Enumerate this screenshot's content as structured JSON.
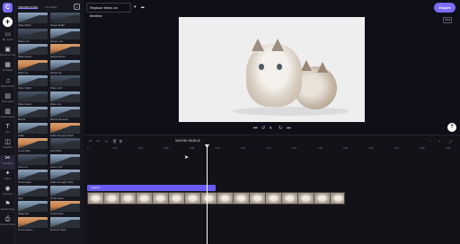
{
  "rail": {
    "logo": "C",
    "items": [
      {
        "icon": "▭",
        "label": "My media"
      },
      {
        "icon": "▣",
        "label": "Record & create"
      },
      {
        "icon": "▦",
        "label": "Templates"
      },
      {
        "icon": "♫",
        "label": "Music & SFX"
      },
      {
        "icon": "▤",
        "label": "Stock video"
      },
      {
        "icon": "▥",
        "label": "Stock images"
      },
      {
        "icon": "T",
        "label": "Text"
      },
      {
        "icon": "◫",
        "label": "Graphics"
      },
      {
        "icon": "✂",
        "label": "Transitions"
      },
      {
        "icon": "✦",
        "label": "Filters"
      },
      {
        "icon": "◉",
        "label": "Brand kit"
      },
      {
        "icon": "⚑",
        "label": "Feature flags"
      },
      {
        "icon": "⎙",
        "label": "Version history"
      }
    ]
  },
  "panel": {
    "tab_active": "TRANSITIONS",
    "tab_other": "FILTERS",
    "tiles": [
      [
        "Slide Right",
        "Swipe Right"
      ],
      [
        "Slide Left",
        "Swipe Left"
      ],
      [
        "Slide Down",
        "Swipe Down"
      ],
      [
        "Slide Up",
        "Swipe Up"
      ],
      [
        "Wipe Right",
        "Wipe Left"
      ],
      [
        "Wipe Down",
        "Wipe Up"
      ],
      [
        "Blinds",
        "Blinds Reverse"
      ],
      [
        "Fade",
        "Fade through black"
      ],
      [
        "Cross Blur",
        "Hard Blur"
      ],
      [
        "Zoom In",
        "Zoom Out"
      ],
      [
        "Cross fade",
        "Fade through white"
      ],
      [
        "Spin",
        "Circle wipe"
      ],
      [
        "Diagonal",
        "Clock wipe"
      ],
      [
        "Cross Zoom",
        "Smooth wipe"
      ]
    ]
  },
  "header": {
    "project_title": "Replace items on timeline",
    "export_label": "Export",
    "aspect": "16:9"
  },
  "playback": {
    "time_current": "00:09.96",
    "time_total": "00:28.15"
  },
  "timeline": {
    "caption_label": "Caption",
    "ticks": [
      "0",
      "0:02",
      "0:04",
      "0:06",
      "0:08",
      "0:10",
      "0:12",
      "0:14",
      "0:16",
      "0:18",
      "0:20",
      "0:22",
      "0:24",
      "0:26",
      "0:28"
    ]
  }
}
